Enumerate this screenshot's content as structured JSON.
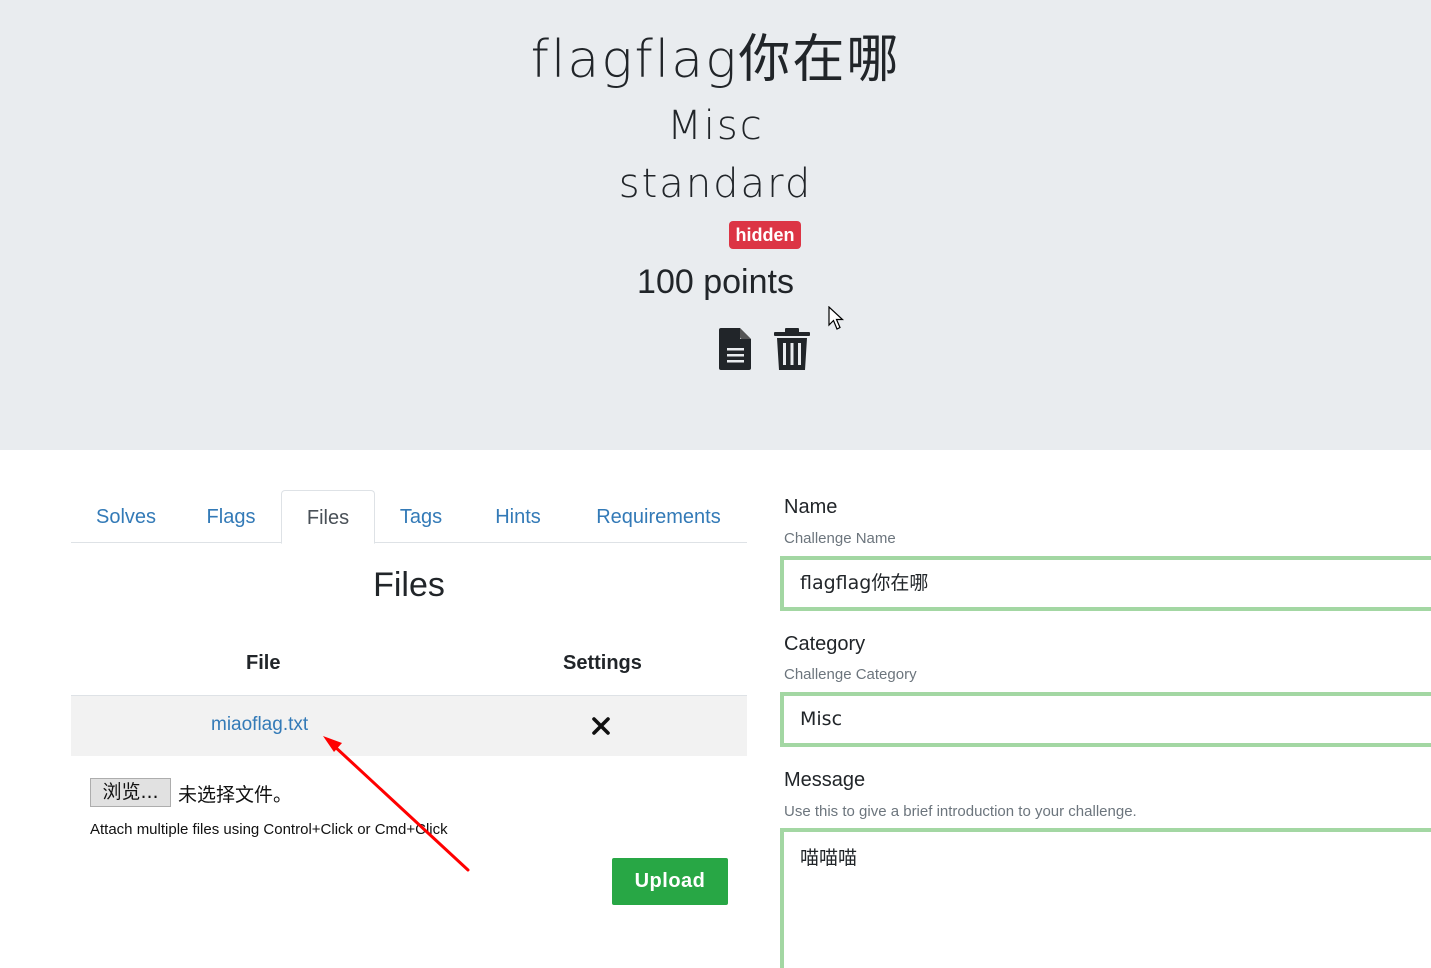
{
  "challenge": {
    "title": "flagflag你在哪",
    "category": "Misc",
    "type": "standard",
    "state_badge": "hidden",
    "points": "100 points",
    "badge_color": "#dc3545"
  },
  "header_icons": [
    "file-icon",
    "trash-icon"
  ],
  "tabs": [
    {
      "label": "Solves",
      "active": false
    },
    {
      "label": "Flags",
      "active": false
    },
    {
      "label": "Files",
      "active": true
    },
    {
      "label": "Tags",
      "active": false
    },
    {
      "label": "Hints",
      "active": false
    },
    {
      "label": "Requirements",
      "active": false
    }
  ],
  "files_section": {
    "heading": "Files",
    "columns": [
      "File",
      "Settings"
    ],
    "rows": [
      {
        "file": "miaoflag.txt",
        "setting_icon": "close-icon"
      }
    ],
    "browse_label": "浏览...",
    "no_file_text": "未选择文件。",
    "help_text": "Attach multiple files using Control+Click or Cmd+Click",
    "upload_label": "Upload",
    "upload_color": "#28a745"
  },
  "form": {
    "name": {
      "label": "Name",
      "help": "Challenge Name",
      "value": "flagflag你在哪"
    },
    "category": {
      "label": "Category",
      "help": "Challenge Category",
      "value": "Misc"
    },
    "message": {
      "label": "Message",
      "help": "Use this to give a brief introduction to your challenge.",
      "value": "喵喵喵"
    }
  },
  "accent_color": "#337ab7",
  "valid_border_color": "#a3d7a3"
}
